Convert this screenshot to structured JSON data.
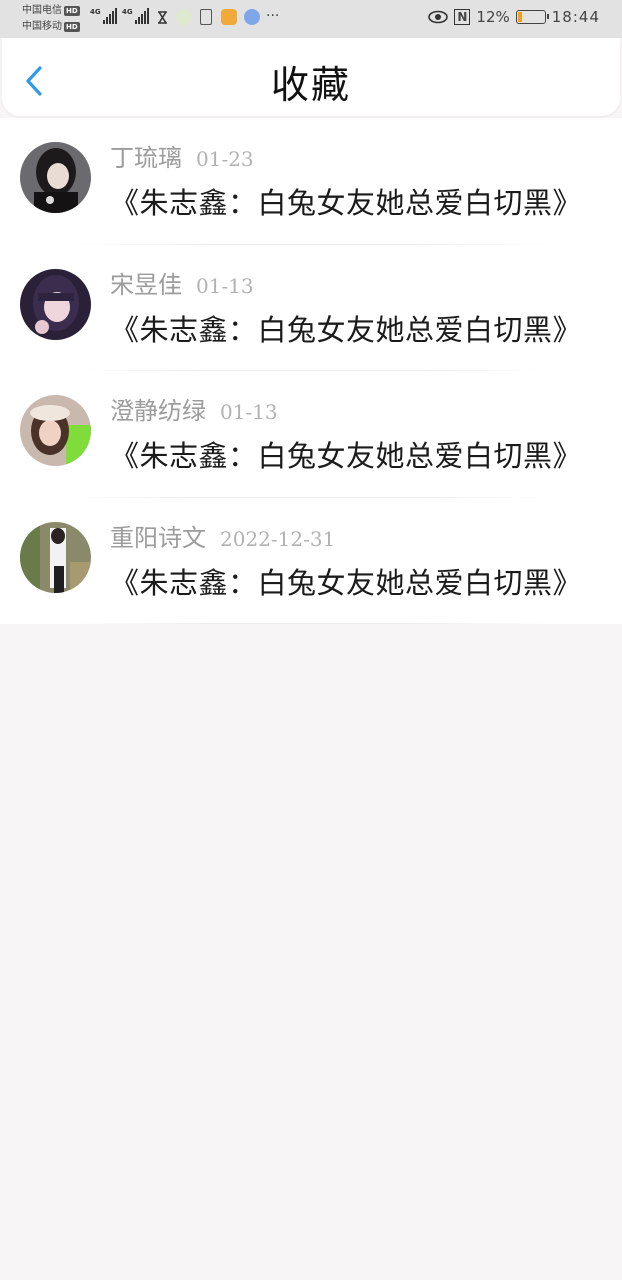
{
  "status_bar": {
    "carrier1": "中国电信",
    "carrier2": "中国移动",
    "hd": "HD",
    "network1": "4G",
    "network2": "4G",
    "more": "···",
    "nfc": "N",
    "battery_percent": "12%",
    "battery_level": 0.12,
    "time": "18:44"
  },
  "header": {
    "title": "收藏"
  },
  "favorites": [
    {
      "name": "丁琉璃",
      "date": "01-23",
      "content": "《朱志鑫：白兔女友她总爱白切黑》"
    },
    {
      "name": "宋昱佳",
      "date": "01-13",
      "content": "《朱志鑫：白兔女友她总爱白切黑》"
    },
    {
      "name": "澄静纺绿",
      "date": "01-13",
      "content": "《朱志鑫：白兔女友她总爱白切黑》"
    },
    {
      "name": "重阳诗文",
      "date": "2022-12-31",
      "content": "《朱志鑫：白兔女友她总爱白切黑》"
    }
  ],
  "colors": {
    "accent": "#2e9bea",
    "background": "#f7f5f6"
  }
}
